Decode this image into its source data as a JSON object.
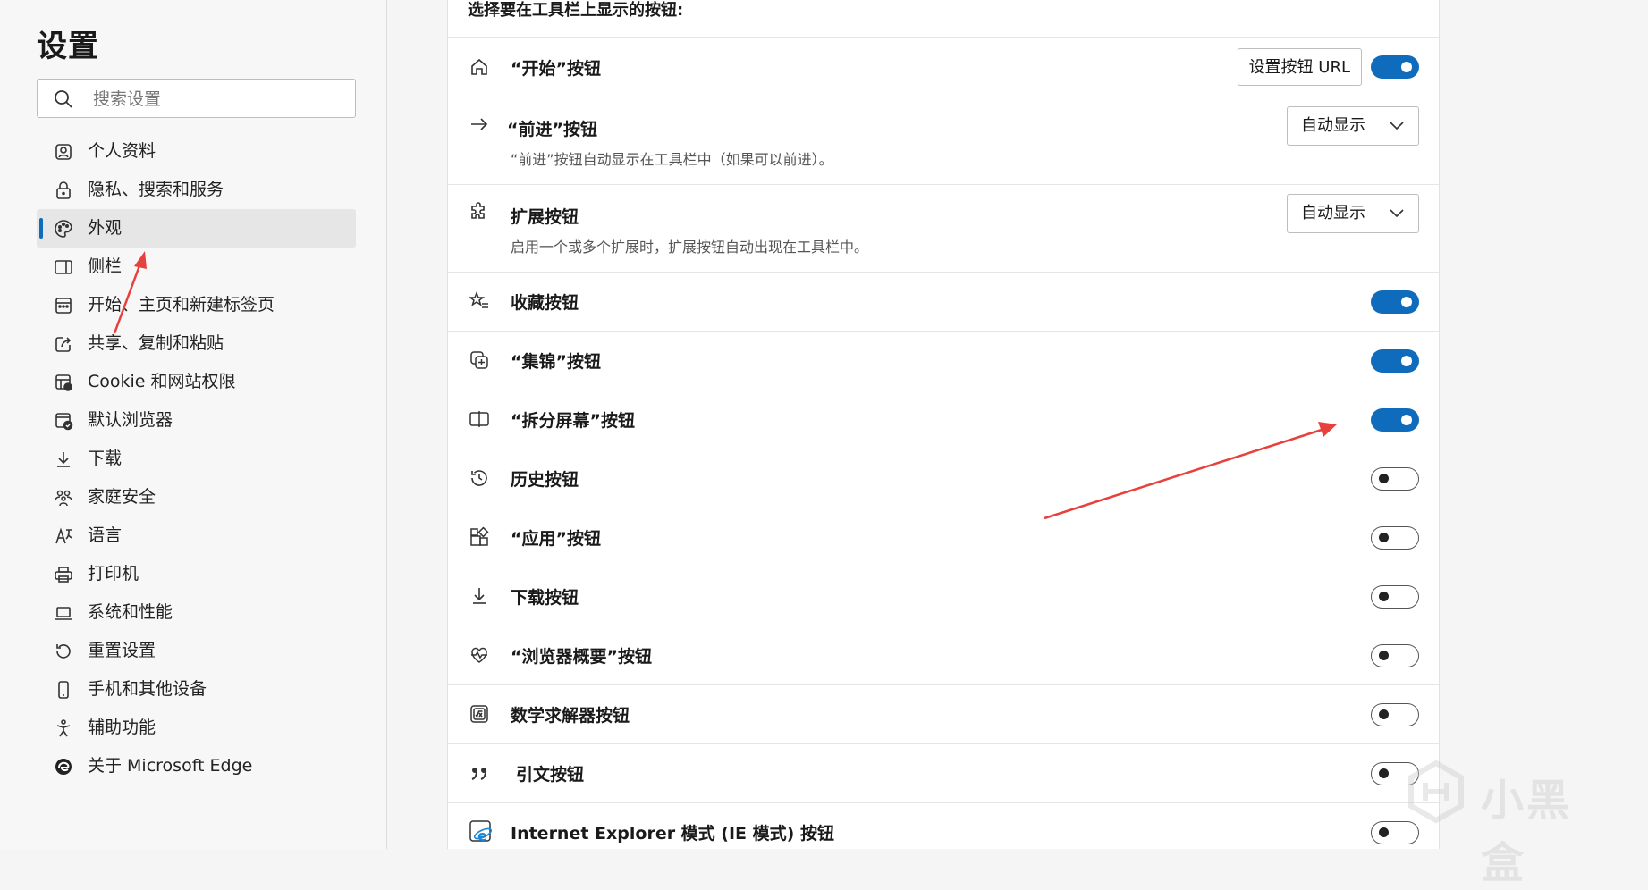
{
  "sidebar": {
    "title": "设置",
    "search": {
      "placeholder": "搜索设置",
      "icon": "search-icon"
    },
    "items": [
      {
        "label": "个人资料",
        "icon": "profile-icon",
        "active": false
      },
      {
        "label": "隐私、搜索和服务",
        "icon": "lock-icon",
        "active": false
      },
      {
        "label": "外观",
        "icon": "palette-icon",
        "active": true
      },
      {
        "label": "侧栏",
        "icon": "sidebar-icon",
        "active": false
      },
      {
        "label": "开始、主页和新建标签页",
        "icon": "start-page-icon",
        "active": false
      },
      {
        "label": "共享、复制和粘贴",
        "icon": "share-icon",
        "active": false
      },
      {
        "label": "Cookie 和网站权限",
        "icon": "cookie-icon",
        "active": false
      },
      {
        "label": "默认浏览器",
        "icon": "default-browser-icon",
        "active": false
      },
      {
        "label": "下载",
        "icon": "download-icon",
        "active": false
      },
      {
        "label": "家庭安全",
        "icon": "family-icon",
        "active": false
      },
      {
        "label": "语言",
        "icon": "language-icon",
        "active": false
      },
      {
        "label": "打印机",
        "icon": "printer-icon",
        "active": false
      },
      {
        "label": "系统和性能",
        "icon": "laptop-icon",
        "active": false
      },
      {
        "label": "重置设置",
        "icon": "reset-icon",
        "active": false
      },
      {
        "label": "手机和其他设备",
        "icon": "phone-icon",
        "active": false
      },
      {
        "label": "辅助功能",
        "icon": "accessibility-icon",
        "active": false
      },
      {
        "label": "关于 Microsoft Edge",
        "icon": "edge-logo-icon",
        "active": false
      }
    ]
  },
  "main": {
    "section_title": "选择要在工具栏上显示的按钮:",
    "rows": [
      {
        "label": "“开始”按钮",
        "icon": "home-icon",
        "control": "toggle",
        "on": true,
        "button_label": "设置按钮 URL"
      },
      {
        "label": "“前进”按钮",
        "icon": "arrow-right-icon",
        "control": "select",
        "select_value": "自动显示",
        "desc": "“前进”按钮自动显示在工具栏中（如果可以前进）。"
      },
      {
        "label": "扩展按钮",
        "icon": "puzzle-icon",
        "control": "select",
        "select_value": "自动显示",
        "desc": "启用一个或多个扩展时，扩展按钮自动出现在工具栏中。"
      },
      {
        "label": "收藏按钮",
        "icon": "favorites-icon",
        "control": "toggle",
        "on": true
      },
      {
        "label": "“集锦”按钮",
        "icon": "collections-icon",
        "control": "toggle",
        "on": true
      },
      {
        "label": "“拆分屏幕”按钮",
        "icon": "split-screen-icon",
        "control": "toggle",
        "on": true
      },
      {
        "label": "历史按钮",
        "icon": "history-icon",
        "control": "toggle",
        "on": false
      },
      {
        "label": "“应用”按钮",
        "icon": "apps-icon",
        "control": "toggle",
        "on": false
      },
      {
        "label": "下载按钮",
        "icon": "download-icon",
        "control": "toggle",
        "on": false
      },
      {
        "label": "“浏览器概要”按钮",
        "icon": "heart-pulse-icon",
        "control": "toggle",
        "on": false
      },
      {
        "label": "数学求解器按钮",
        "icon": "math-solver-icon",
        "control": "toggle",
        "on": false
      },
      {
        "label": "引文按钮",
        "icon": "quote-icon",
        "control": "toggle",
        "on": false
      },
      {
        "label": "Internet Explorer 模式 (IE 模式) 按钮",
        "icon": "ie-icon",
        "control": "toggle",
        "on": false
      }
    ]
  },
  "watermark": {
    "text": "小黑盒",
    "icon": "heybox-logo-icon"
  },
  "colors": {
    "accent": "#0f6cbd",
    "annotation": "#e8403c"
  }
}
